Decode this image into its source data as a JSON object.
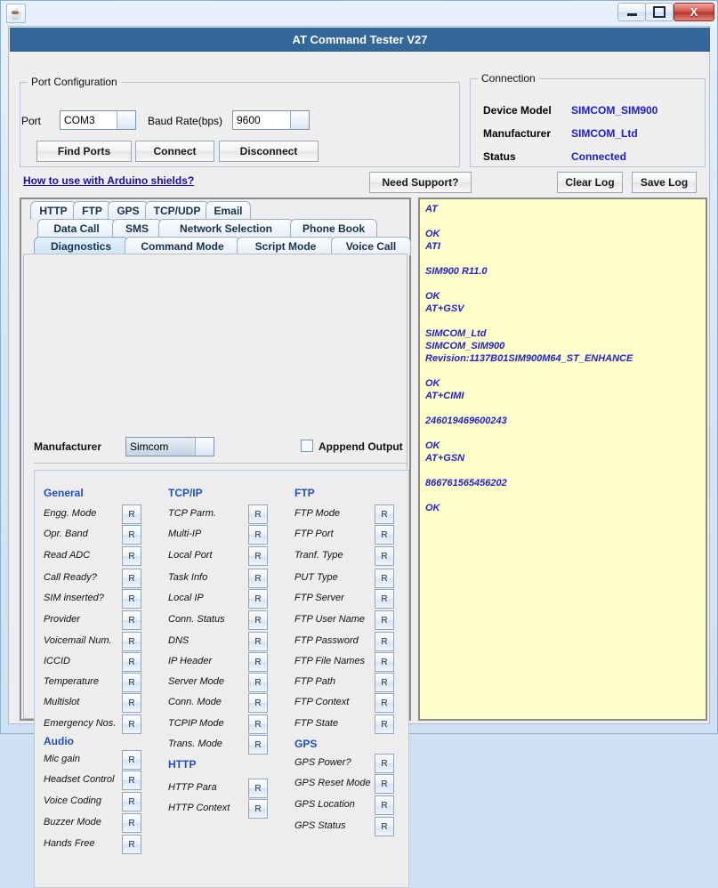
{
  "window": {
    "icon": "java-coffee-cup-icon",
    "minimize_label": "",
    "maximize_label": "",
    "close_label": "X"
  },
  "app": {
    "title": "AT Command Tester V27"
  },
  "port_configuration": {
    "legend": "Port Configuration",
    "port_label": "Port",
    "port_value": "COM3",
    "baud_label": "Baud Rate(bps)",
    "baud_value": "9600",
    "find_ports_label": "Find Ports",
    "connect_label": "Connect",
    "disconnect_label": "Disconnect"
  },
  "connection": {
    "legend": "Connection",
    "device_model_label": "Device Model",
    "device_model_value": "SIMCOM_SIM900",
    "manufacturer_label": "Manufacturer",
    "manufacturer_value": "SIMCOM_Ltd",
    "status_label": "Status",
    "status_value": "Connected",
    "value_color": "#1c1ce0"
  },
  "toolbar": {
    "arduino_link": "How to use with Arduino shields?",
    "need_support_label": "Need Support?",
    "clear_log_label": "Clear Log",
    "save_log_label": "Save Log"
  },
  "tabs": {
    "row1": [
      {
        "label": "HTTP",
        "selected": false
      },
      {
        "label": "FTP",
        "selected": false
      },
      {
        "label": "GPS",
        "selected": false
      },
      {
        "label": "TCP/UDP",
        "selected": false
      },
      {
        "label": "Email",
        "selected": false
      }
    ],
    "row2": [
      {
        "label": "Data Call",
        "selected": false
      },
      {
        "label": "SMS",
        "selected": false
      },
      {
        "label": "Network Selection",
        "selected": false
      },
      {
        "label": "Phone Book",
        "selected": false
      }
    ],
    "row3": [
      {
        "label": "Diagnostics",
        "selected": true
      },
      {
        "label": "Command Mode",
        "selected": false
      },
      {
        "label": "Script Mode",
        "selected": false
      },
      {
        "label": "Voice Call",
        "selected": false
      }
    ]
  },
  "diagnostics": {
    "manufacturer_label": "Manufacturer",
    "manufacturer_value": "Simcom",
    "append_output_label": "Apppend Output",
    "append_output_checked": false,
    "read_button_label": "R",
    "section_color": "#2050c0",
    "columns": [
      {
        "name": "column-1",
        "entries": [
          {
            "type": "section",
            "label": "General"
          },
          {
            "type": "row",
            "label": "Engg. Mode"
          },
          {
            "type": "row",
            "label": "Opr. Band"
          },
          {
            "type": "row",
            "label": "Read ADC"
          },
          {
            "type": "row",
            "label": "Call Ready?"
          },
          {
            "type": "row",
            "label": "SIM inserted?"
          },
          {
            "type": "row",
            "label": "Provider"
          },
          {
            "type": "row",
            "label": "Voicemail Num."
          },
          {
            "type": "row",
            "label": "ICCID"
          },
          {
            "type": "row",
            "label": "Temperature"
          },
          {
            "type": "row",
            "label": "Multislot"
          },
          {
            "type": "row",
            "label": "Emergency Nos."
          },
          {
            "type": "section",
            "label": "Audio"
          },
          {
            "type": "row",
            "label": "Mic gain"
          },
          {
            "type": "row",
            "label": "Headset Control"
          },
          {
            "type": "row",
            "label": "Voice Coding"
          },
          {
            "type": "row",
            "label": "Buzzer Mode"
          },
          {
            "type": "row",
            "label": "Hands Free"
          }
        ]
      },
      {
        "name": "column-2",
        "entries": [
          {
            "type": "section",
            "label": "TCP/IP"
          },
          {
            "type": "row",
            "label": "TCP Parm."
          },
          {
            "type": "row",
            "label": "Multi-IP"
          },
          {
            "type": "row",
            "label": "Local Port"
          },
          {
            "type": "row",
            "label": "Task Info"
          },
          {
            "type": "row",
            "label": "Local IP"
          },
          {
            "type": "row",
            "label": "Conn. Status"
          },
          {
            "type": "row",
            "label": "DNS"
          },
          {
            "type": "row",
            "label": "IP Header"
          },
          {
            "type": "row",
            "label": "Server Mode"
          },
          {
            "type": "row",
            "label": "Conn. Mode"
          },
          {
            "type": "row",
            "label": "TCPIP Mode"
          },
          {
            "type": "row",
            "label": "Trans. Mode"
          },
          {
            "type": "section",
            "label": "HTTP"
          },
          {
            "type": "row",
            "label": "HTTP Para"
          },
          {
            "type": "row",
            "label": "HTTP Context"
          }
        ]
      },
      {
        "name": "column-3",
        "entries": [
          {
            "type": "section",
            "label": "FTP"
          },
          {
            "type": "row",
            "label": "FTP Mode"
          },
          {
            "type": "row",
            "label": "FTP Port"
          },
          {
            "type": "row",
            "label": "Tranf. Type"
          },
          {
            "type": "row",
            "label": "PUT Type"
          },
          {
            "type": "row",
            "label": "FTP Server"
          },
          {
            "type": "row",
            "label": "FTP User Name"
          },
          {
            "type": "row",
            "label": "FTP Password"
          },
          {
            "type": "row",
            "label": "FTP  File Names"
          },
          {
            "type": "row",
            "label": "FTP Path"
          },
          {
            "type": "row",
            "label": "FTP Context"
          },
          {
            "type": "row",
            "label": "FTP State"
          },
          {
            "type": "section",
            "label": "GPS"
          },
          {
            "type": "row",
            "label": "GPS Power?"
          },
          {
            "type": "row",
            "label": "GPS Reset  Mode"
          },
          {
            "type": "row",
            "label": "GPS Location"
          },
          {
            "type": "row",
            "label": "GPS Status"
          }
        ]
      }
    ]
  },
  "log": {
    "background": "#ffffcc",
    "text_color": "#2222cc",
    "content": "AT\n\nOK\nATI\n\nSIM900 R11.0\n\nOK\nAT+GSV\n\nSIMCOM_Ltd\nSIMCOM_SIM900\nRevision:1137B01SIM900M64_ST_ENHANCE\n\nOK\nAT+CIMI\n\n246019469600243\n\nOK\nAT+GSN\n\n866761565456202\n\nOK"
  }
}
